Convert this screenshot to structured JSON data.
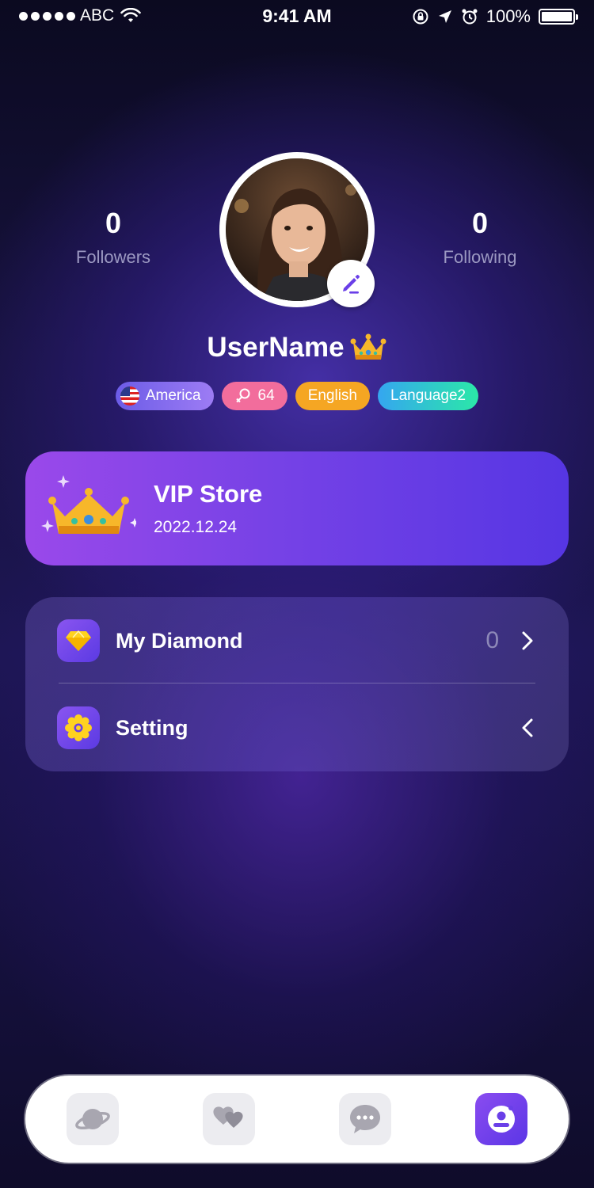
{
  "status_bar": {
    "carrier": "ABC",
    "time": "9:41 AM",
    "battery": "100%"
  },
  "profile": {
    "followers_count": "0",
    "followers_label": "Followers",
    "following_count": "0",
    "following_label": "Following",
    "username": "UserName",
    "avatar_icon": "profile-photo",
    "edit_icon": "pencil-icon"
  },
  "tags": {
    "country": "America",
    "age": "64",
    "language1": "English",
    "language2": "Language2"
  },
  "vip": {
    "title": "VIP Store",
    "date": "2022.12.24"
  },
  "menu": {
    "diamond_label": "My Diamond",
    "diamond_value": "0",
    "setting_label": "Setting"
  },
  "bottom_nav": {
    "items": [
      "planet-icon",
      "hearts-icon",
      "chat-icon",
      "profile-icon"
    ],
    "active_index": 3
  },
  "colors": {
    "accent": "#6a3fe8",
    "vip_start": "#9a49ea",
    "vip_end": "#5636e3",
    "tag_age": "#f26d9c",
    "tag_lang1": "#f5a623"
  }
}
